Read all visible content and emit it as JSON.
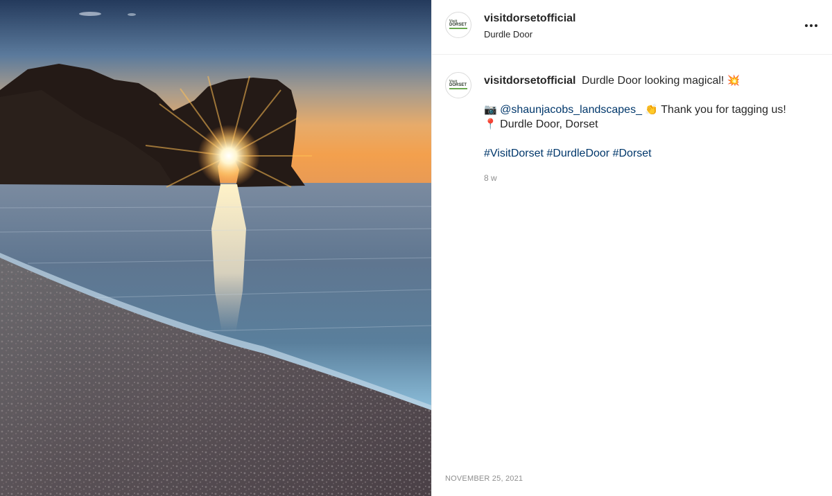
{
  "post": {
    "username": "visitdorsetofficial",
    "location": "Durdle Door",
    "avatar_logo": {
      "line1": "Visit",
      "line2": "DORSET"
    },
    "more_icon": "more-horizontal-icon",
    "caption": {
      "username": "visitdorsetofficial",
      "headline": "Durdle Door looking magical!",
      "headline_emoji": "💥",
      "camera_emoji": "📷",
      "mention": "@shaunjacobs_landscapes_",
      "clap_emoji": "👏",
      "thanks": "Thank you for tagging us!",
      "pin_emoji": "📍",
      "place": "Durdle Door, Dorset",
      "hashtags": [
        "#VisitDorset",
        "#DurdleDoor",
        "#Dorset"
      ]
    },
    "time_ago": "8 w",
    "date": "NOVEMBER 25, 2021"
  },
  "colors": {
    "link": "#00376b",
    "text": "#262626",
    "muted": "#8e8e8e",
    "divider": "#efefef"
  }
}
